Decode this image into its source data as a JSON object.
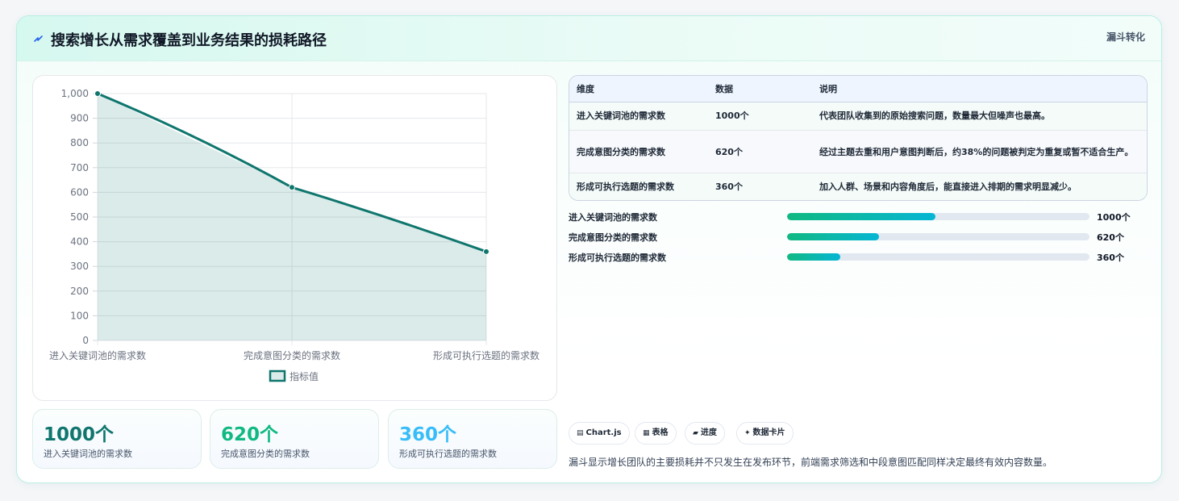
{
  "header": {
    "title": "搜索增长从需求覆盖到业务结果的损耗路径",
    "tag": "漏斗转化",
    "icon": "lightning-icon"
  },
  "chart_data": {
    "type": "line",
    "categories": [
      "进入关键词池的需求数",
      "完成意图分类的需求数",
      "形成可执行选题的需求数"
    ],
    "series": [
      {
        "name": "指标值",
        "values": [
          1000,
          620,
          360
        ],
        "color": "#0f766e"
      }
    ],
    "yticks": [
      "0",
      "100",
      "200",
      "300",
      "400",
      "500",
      "600",
      "700",
      "800",
      "900",
      "1,000"
    ],
    "ylim": [
      0,
      1000
    ],
    "fill": "area",
    "grid": true,
    "legend": "bottom"
  },
  "kpis": [
    {
      "value": "1000个",
      "label": "进入关键词池的需求数",
      "color": "#0f766e"
    },
    {
      "value": "620个",
      "label": "完成意图分类的需求数",
      "color": "#10b981"
    },
    {
      "value": "360个",
      "label": "形成可执行选题的需求数",
      "color": "#38bdf8"
    }
  ],
  "table": {
    "headers": [
      "维度",
      "数据",
      "说明"
    ],
    "rows": [
      [
        "进入关键词池的需求数",
        "1000个",
        "代表团队收集到的原始搜索问题，数量最大但噪声也最高。"
      ],
      [
        "完成意图分类的需求数",
        "620个",
        "经过主题去重和用户意图判断后，约38%的问题被判定为重复或暂不适合生产。"
      ],
      [
        "形成可执行选题的需求数",
        "360个",
        "加入人群、场景和内容角度后，能直接进入排期的需求明显减少。"
      ]
    ]
  },
  "progress": [
    {
      "label": "进入关键词池的需求数",
      "value": "1000个",
      "fraction": 0.49
    },
    {
      "label": "完成意图分类的需求数",
      "value": "620个",
      "fraction": 0.304
    },
    {
      "label": "形成可执行选题的需求数",
      "value": "360个",
      "fraction": 0.176
    }
  ],
  "chips": [
    {
      "icon": "▤",
      "label": "Chart.js"
    },
    {
      "icon": "▦",
      "label": "表格"
    },
    {
      "icon": "▰",
      "label": "进度"
    },
    {
      "icon": "✦",
      "label": "数据卡片"
    }
  ],
  "note": "漏斗显示增长团队的主要损耗并不只发生在发布环节，前端需求筛选和中段意图匹配同样决定最终有效内容数量。"
}
